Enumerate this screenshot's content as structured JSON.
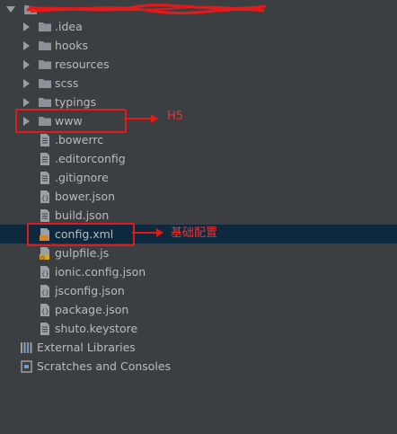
{
  "project_tree": {
    "root_label": "",
    "items": [
      {
        "label": ".idea",
        "type": "folder"
      },
      {
        "label": "hooks",
        "type": "folder"
      },
      {
        "label": "resources",
        "type": "folder"
      },
      {
        "label": "scss",
        "type": "folder"
      },
      {
        "label": "typings",
        "type": "folder"
      },
      {
        "label": "www",
        "type": "folder"
      },
      {
        "label": ".bowerrc",
        "type": "text-file"
      },
      {
        "label": ".editorconfig",
        "type": "text-file"
      },
      {
        "label": ".gitignore",
        "type": "text-file"
      },
      {
        "label": "bower.json",
        "type": "json-file"
      },
      {
        "label": "build.json",
        "type": "text-file"
      },
      {
        "label": "config.xml",
        "type": "xml-file",
        "selected": true
      },
      {
        "label": "gulpfile.js",
        "type": "js-file"
      },
      {
        "label": "ionic.config.json",
        "type": "json-file"
      },
      {
        "label": "jsconfig.json",
        "type": "json-file"
      },
      {
        "label": "package.json",
        "type": "json-file"
      },
      {
        "label": "shuto.keystore",
        "type": "text-file"
      }
    ],
    "external_libraries": "External Libraries",
    "scratches": "Scratches and Consoles"
  },
  "annotations": {
    "www_note": "H5",
    "config_note": "基础配置",
    "color": "#e41a1a"
  }
}
